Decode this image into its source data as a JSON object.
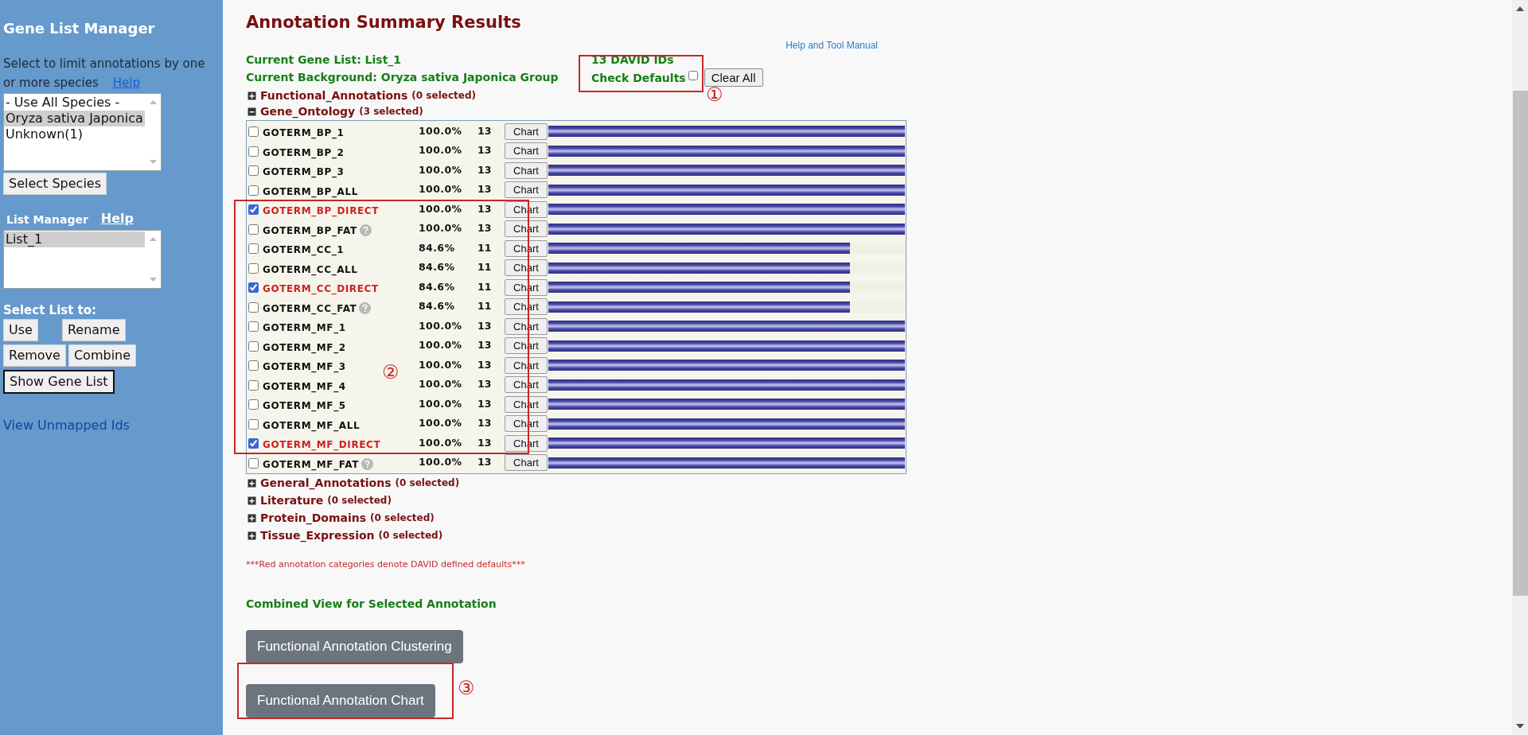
{
  "sidebar": {
    "title": "Gene List Manager",
    "species_hint": "Select to limit annotations by one or more species",
    "species_help": "Help",
    "species_options": [
      {
        "label": "- Use All Species -",
        "selected": false
      },
      {
        "label": "Oryza sativa Japonica",
        "selected": true
      },
      {
        "label": "Unknown(1)",
        "selected": false
      }
    ],
    "select_species_button": "Select Species",
    "list_manager_label": "List Manager",
    "list_manager_help": "Help",
    "lists": [
      {
        "label": "List_1",
        "selected": true
      }
    ],
    "select_list_label": "Select List to:",
    "list_buttons": [
      {
        "label": "Use",
        "focused": false
      },
      {
        "label": "Rename",
        "focused": false
      },
      {
        "label": "Remove",
        "focused": false
      },
      {
        "label": "Combine",
        "focused": false
      },
      {
        "label": "Show Gene List",
        "focused": true
      }
    ],
    "unmapped_link": "View Unmapped Ids"
  },
  "main": {
    "title": "Annotation Summary Results",
    "help_link": "Help and Tool Manual",
    "current_gene_list": "Current Gene List: List_1",
    "id_count": "13 DAVID IDs",
    "current_background": "Current Background: Oryza sativa Japonica Group",
    "check_defaults": {
      "label": "Check Defaults",
      "checked": false
    },
    "clear_all_button": "Clear All",
    "sections": [
      {
        "name": "Functional_Annotations",
        "count": "(0 selected)",
        "expanded": false
      },
      {
        "name": "Gene_Ontology",
        "count": "(3 selected)",
        "expanded": true,
        "rows": [
          {
            "name": "GOTERM_BP_1",
            "percent": "100.0%",
            "count": "13",
            "button": "Chart",
            "level": 1,
            "checked": false,
            "default": false,
            "help": false
          },
          {
            "name": "GOTERM_BP_2",
            "percent": "100.0%",
            "count": "13",
            "button": "Chart",
            "level": 1,
            "checked": false,
            "default": false,
            "help": false
          },
          {
            "name": "GOTERM_BP_3",
            "percent": "100.0%",
            "count": "13",
            "button": "Chart",
            "level": 1,
            "checked": false,
            "default": false,
            "help": false
          },
          {
            "name": "GOTERM_BP_ALL",
            "percent": "100.0%",
            "count": "13",
            "button": "Chart",
            "level": 1,
            "checked": false,
            "default": false,
            "help": false
          },
          {
            "name": "GOTERM_BP_DIRECT",
            "percent": "100.0%",
            "count": "13",
            "button": "Chart",
            "level": 1,
            "checked": true,
            "default": true,
            "help": false
          },
          {
            "name": "GOTERM_BP_FAT",
            "percent": "100.0%",
            "count": "13",
            "button": "Chart",
            "level": 1,
            "checked": false,
            "default": false,
            "help": true
          },
          {
            "name": "GOTERM_CC_1",
            "percent": "84.6%",
            "count": "11",
            "button": "Chart",
            "level": 0.846,
            "checked": false,
            "default": false,
            "help": false
          },
          {
            "name": "GOTERM_CC_ALL",
            "percent": "84.6%",
            "count": "11",
            "button": "Chart",
            "level": 0.846,
            "checked": false,
            "default": false,
            "help": false
          },
          {
            "name": "GOTERM_CC_DIRECT",
            "percent": "84.6%",
            "count": "11",
            "button": "Chart",
            "level": 0.846,
            "checked": true,
            "default": true,
            "help": false
          },
          {
            "name": "GOTERM_CC_FAT",
            "percent": "84.6%",
            "count": "11",
            "button": "Chart",
            "level": 0.846,
            "checked": false,
            "default": false,
            "help": true
          },
          {
            "name": "GOTERM_MF_1",
            "percent": "100.0%",
            "count": "13",
            "button": "Chart",
            "level": 1,
            "checked": false,
            "default": false,
            "help": false
          },
          {
            "name": "GOTERM_MF_2",
            "percent": "100.0%",
            "count": "13",
            "button": "Chart",
            "level": 1,
            "checked": false,
            "default": false,
            "help": false
          },
          {
            "name": "GOTERM_MF_3",
            "percent": "100.0%",
            "count": "13",
            "button": "Chart",
            "level": 1,
            "checked": false,
            "default": false,
            "help": false
          },
          {
            "name": "GOTERM_MF_4",
            "percent": "100.0%",
            "count": "13",
            "button": "Chart",
            "level": 1,
            "checked": false,
            "default": false,
            "help": false
          },
          {
            "name": "GOTERM_MF_5",
            "percent": "100.0%",
            "count": "13",
            "button": "Chart",
            "level": 1,
            "checked": false,
            "default": false,
            "help": false
          },
          {
            "name": "GOTERM_MF_ALL",
            "percent": "100.0%",
            "count": "13",
            "button": "Chart",
            "level": 1,
            "checked": false,
            "default": false,
            "help": false
          },
          {
            "name": "GOTERM_MF_DIRECT",
            "percent": "100.0%",
            "count": "13",
            "button": "Chart",
            "level": 1,
            "checked": true,
            "default": true,
            "help": false
          },
          {
            "name": "GOTERM_MF_FAT",
            "percent": "100.0%",
            "count": "13",
            "button": "Chart",
            "level": 1,
            "checked": false,
            "default": false,
            "help": true
          }
        ]
      },
      {
        "name": "General_Annotations",
        "count": "(0 selected)",
        "expanded": false
      },
      {
        "name": "Literature",
        "count": "(0 selected)",
        "expanded": false
      },
      {
        "name": "Protein_Domains",
        "count": "(0 selected)",
        "expanded": false
      },
      {
        "name": "Tissue_Expression",
        "count": "(0 selected)",
        "expanded": false
      }
    ],
    "defaults_note": "***Red annotation categories denote DAVID defined defaults***",
    "combined_view_label": "Combined View for Selected Annotation",
    "action_buttons": [
      "Functional Annotation Clustering",
      "Functional Annotation Chart"
    ]
  },
  "markers": [
    "①",
    "②",
    "③"
  ]
}
